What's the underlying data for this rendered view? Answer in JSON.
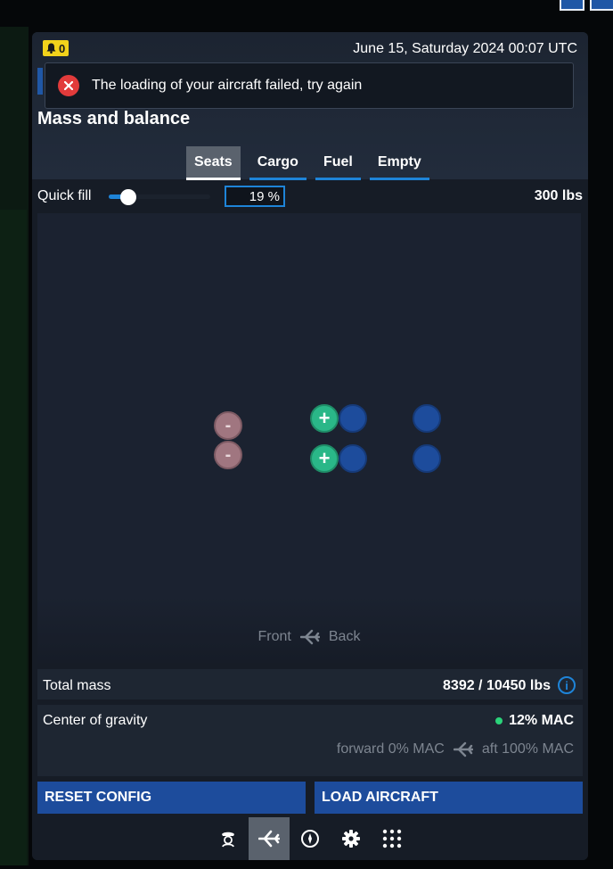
{
  "status": {
    "notification_count": "0",
    "datetime": "June 15, Saturday 2024 00:07 UTC"
  },
  "toast": {
    "message": "The loading of your aircraft failed, try again",
    "icon": "error-x-icon",
    "color": "#e23b3b"
  },
  "page": {
    "title": "Mass and balance"
  },
  "tabs": [
    {
      "label": "Seats",
      "active": true
    },
    {
      "label": "Cargo",
      "active": false
    },
    {
      "label": "Fuel",
      "active": false
    },
    {
      "label": "Empty",
      "active": false
    }
  ],
  "quick_fill": {
    "label": "Quick fill",
    "value": "19 %",
    "slider_percent": 19,
    "weight": "300 lbs"
  },
  "seat_map": {
    "remove_symbol": "-",
    "add_symbol": "+",
    "direction": {
      "front": "Front",
      "back": "Back"
    }
  },
  "total_mass": {
    "label": "Total mass",
    "value": "8392 / 10450 lbs",
    "info_symbol": "i"
  },
  "center_of_gravity": {
    "label": "Center of gravity",
    "value": "12% MAC",
    "status_color": "#2bd37a",
    "forward": "forward 0% MAC",
    "aft": "aft 100% MAC"
  },
  "actions": {
    "reset": "RESET CONFIG",
    "load": "LOAD AIRCRAFT"
  },
  "nav": [
    {
      "icon": "pilot-icon",
      "active": false
    },
    {
      "icon": "airplane-icon",
      "active": true
    },
    {
      "icon": "compass-icon",
      "active": false
    },
    {
      "icon": "gear-icon",
      "active": false
    },
    {
      "icon": "grid-icon",
      "active": false
    }
  ],
  "colors": {
    "accent": "#1e84d8",
    "button": "#1d4c9c",
    "seat_occupied": "#1d4c9c",
    "seat_add": "#2ab788",
    "seat_remove": "#a07680",
    "badge": "#f2d21b"
  }
}
